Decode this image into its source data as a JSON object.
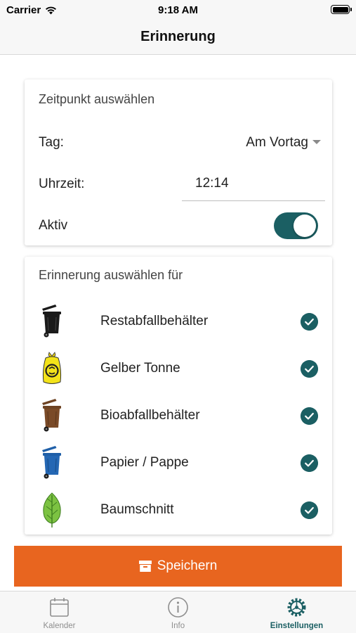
{
  "status_bar": {
    "carrier": "Carrier",
    "time": "9:18 AM"
  },
  "nav": {
    "title": "Erinnerung"
  },
  "time_card": {
    "heading": "Zeitpunkt auswählen",
    "day_label": "Tag:",
    "day_value": "Am Vortag",
    "time_label": "Uhrzeit:",
    "time_value": "12:14",
    "active_label": "Aktiv",
    "active_on": true
  },
  "select_card": {
    "heading": "Erinnerung auswählen für",
    "items": [
      {
        "label": "Restabfallbehälter",
        "icon": "black-bin-icon",
        "checked": true
      },
      {
        "label": "Gelber Tonne",
        "icon": "yellow-bag-icon",
        "checked": true
      },
      {
        "label": "Bioabfallbehälter",
        "icon": "brown-bin-icon",
        "checked": true
      },
      {
        "label": "Papier / Pappe",
        "icon": "blue-bin-icon",
        "checked": true
      },
      {
        "label": "Baumschnitt",
        "icon": "leaf-icon",
        "checked": true
      }
    ]
  },
  "save_button": {
    "label": "Speichern",
    "icon": "archive-box-icon"
  },
  "tabs": [
    {
      "label": "Kalender",
      "icon": "calendar-icon",
      "active": false
    },
    {
      "label": "Info",
      "icon": "info-icon",
      "active": false
    },
    {
      "label": "Einstellungen",
      "icon": "settings-gear-icon",
      "active": true
    }
  ],
  "colors": {
    "accent": "#1b5f63",
    "save_button": "#e8651f",
    "bar_background": "#f7f7f7"
  }
}
